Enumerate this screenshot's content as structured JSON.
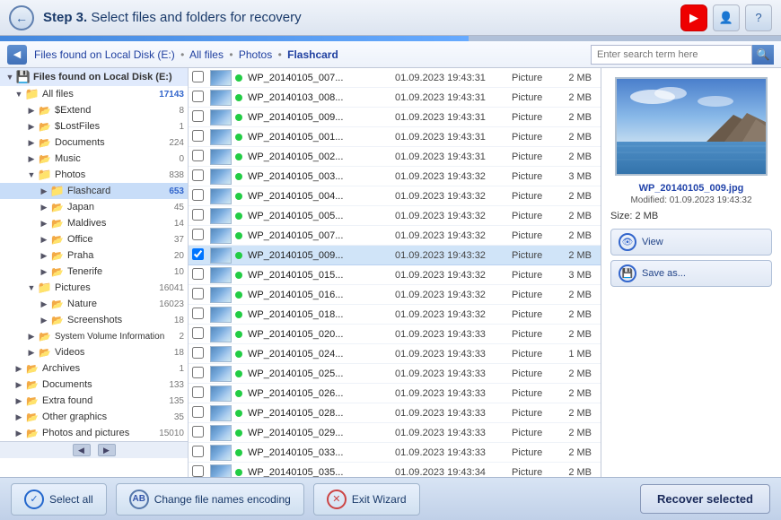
{
  "titleBar": {
    "stepLabel": "Step 3.",
    "stepDesc": " Select files and folders for recovery",
    "backBtn": "←",
    "youtubeIcon": "▶",
    "userIcon": "👤",
    "helpIcon": "?"
  },
  "breadcrumb": {
    "navIcon": "◀",
    "parts": [
      "Files found on Local Disk (E:)",
      "All files",
      "Photos",
      "Flashcard"
    ],
    "searchPlaceholder": "Enter search term here",
    "searchIcon": "🔍"
  },
  "sidebar": {
    "items": [
      {
        "label": "Files found on Local Disk (E:)",
        "level": 0,
        "type": "root",
        "expanded": true
      },
      {
        "label": "All files",
        "count": "17143",
        "level": 1,
        "type": "folder",
        "expanded": true,
        "selected": false,
        "countStyle": "blue"
      },
      {
        "label": "$Extend",
        "count": "8",
        "level": 2,
        "type": "folder"
      },
      {
        "label": "$LostFiles",
        "count": "1",
        "level": 2,
        "type": "folder"
      },
      {
        "label": "Documents",
        "count": "224",
        "level": 2,
        "type": "folder"
      },
      {
        "label": "Music",
        "count": "0",
        "level": 2,
        "type": "folder"
      },
      {
        "label": "Photos",
        "count": "838",
        "level": 2,
        "type": "folder",
        "expanded": true
      },
      {
        "label": "Flashcard",
        "count": "653",
        "level": 3,
        "type": "folder",
        "selected": true
      },
      {
        "label": "Japan",
        "count": "45",
        "level": 3,
        "type": "folder"
      },
      {
        "label": "Maldives",
        "count": "14",
        "level": 3,
        "type": "folder"
      },
      {
        "label": "Office",
        "count": "37",
        "level": 3,
        "type": "folder"
      },
      {
        "label": "Praha",
        "count": "20",
        "level": 3,
        "type": "folder"
      },
      {
        "label": "Tenerife",
        "count": "10",
        "level": 3,
        "type": "folder"
      },
      {
        "label": "Pictures",
        "count": "16041",
        "level": 2,
        "type": "folder",
        "expanded": true
      },
      {
        "label": "Nature",
        "count": "16023",
        "level": 3,
        "type": "folder"
      },
      {
        "label": "Screenshots",
        "count": "18",
        "level": 3,
        "type": "folder"
      },
      {
        "label": "System Volume Information",
        "count": "2",
        "level": 2,
        "type": "folder"
      },
      {
        "label": "Videos",
        "count": "18",
        "level": 2,
        "type": "folder"
      },
      {
        "label": "Archives",
        "count": "1",
        "level": 1,
        "type": "folder"
      },
      {
        "label": "Documents",
        "count": "133",
        "level": 1,
        "type": "folder"
      },
      {
        "label": "Extra found",
        "count": "135",
        "level": 1,
        "type": "folder"
      },
      {
        "label": "Other graphics",
        "count": "35",
        "level": 1,
        "type": "folder"
      },
      {
        "label": "Photos and pictures",
        "count": "15010",
        "level": 1,
        "type": "folder"
      }
    ]
  },
  "fileList": {
    "rows": [
      {
        "name": "WP_20140105_007...",
        "date": "01.09.2023 19:43:31",
        "type": "Picture",
        "size": "2 MB",
        "dot": "green",
        "selected": false
      },
      {
        "name": "WP_20140103_008...",
        "date": "01.09.2023 19:43:31",
        "type": "Picture",
        "size": "2 MB",
        "dot": "green",
        "selected": false
      },
      {
        "name": "WP_20140105_009...",
        "date": "01.09.2023 19:43:31",
        "type": "Picture",
        "size": "2 MB",
        "dot": "green",
        "selected": false
      },
      {
        "name": "WP_20140105_001...",
        "date": "01.09.2023 19:43:31",
        "type": "Picture",
        "size": "2 MB",
        "dot": "green",
        "selected": false
      },
      {
        "name": "WP_20140105_002...",
        "date": "01.09.2023 19:43:31",
        "type": "Picture",
        "size": "2 MB",
        "dot": "green",
        "selected": false
      },
      {
        "name": "WP_20140105_003...",
        "date": "01.09.2023 19:43:32",
        "type": "Picture",
        "size": "3 MB",
        "dot": "green",
        "selected": false
      },
      {
        "name": "WP_20140105_004...",
        "date": "01.09.2023 19:43:32",
        "type": "Picture",
        "size": "2 MB",
        "dot": "green",
        "selected": false
      },
      {
        "name": "WP_20140105_005...",
        "date": "01.09.2023 19:43:32",
        "type": "Picture",
        "size": "2 MB",
        "dot": "green",
        "selected": false
      },
      {
        "name": "WP_20140105_007...",
        "date": "01.09.2023 19:43:32",
        "type": "Picture",
        "size": "2 MB",
        "dot": "green",
        "selected": false
      },
      {
        "name": "WP_20140105_009...",
        "date": "01.09.2023 19:43:32",
        "type": "Picture",
        "size": "2 MB",
        "dot": "green",
        "selected": true
      },
      {
        "name": "WP_20140105_015...",
        "date": "01.09.2023 19:43:32",
        "type": "Picture",
        "size": "3 MB",
        "dot": "green",
        "selected": false
      },
      {
        "name": "WP_20140105_016...",
        "date": "01.09.2023 19:43:32",
        "type": "Picture",
        "size": "2 MB",
        "dot": "green",
        "selected": false
      },
      {
        "name": "WP_20140105_018...",
        "date": "01.09.2023 19:43:32",
        "type": "Picture",
        "size": "2 MB",
        "dot": "green",
        "selected": false
      },
      {
        "name": "WP_20140105_020...",
        "date": "01.09.2023 19:43:33",
        "type": "Picture",
        "size": "2 MB",
        "dot": "green",
        "selected": false
      },
      {
        "name": "WP_20140105_024...",
        "date": "01.09.2023 19:43:33",
        "type": "Picture",
        "size": "1 MB",
        "dot": "green",
        "selected": false
      },
      {
        "name": "WP_20140105_025...",
        "date": "01.09.2023 19:43:33",
        "type": "Picture",
        "size": "2 MB",
        "dot": "green",
        "selected": false
      },
      {
        "name": "WP_20140105_026...",
        "date": "01.09.2023 19:43:33",
        "type": "Picture",
        "size": "2 MB",
        "dot": "green",
        "selected": false
      },
      {
        "name": "WP_20140105_028...",
        "date": "01.09.2023 19:43:33",
        "type": "Picture",
        "size": "2 MB",
        "dot": "green",
        "selected": false
      },
      {
        "name": "WP_20140105_029...",
        "date": "01.09.2023 19:43:33",
        "type": "Picture",
        "size": "2 MB",
        "dot": "green",
        "selected": false
      },
      {
        "name": "WP_20140105_033...",
        "date": "01.09.2023 19:43:33",
        "type": "Picture",
        "size": "2 MB",
        "dot": "green",
        "selected": false
      },
      {
        "name": "WP_20140105_035...",
        "date": "01.09.2023 19:43:34",
        "type": "Picture",
        "size": "2 MB",
        "dot": "green",
        "selected": false
      }
    ]
  },
  "preview": {
    "filename": "WP_20140105_009.jpg",
    "modified": "Modified: 01.09.2023 19:43:32",
    "size": "Size: 2 MB",
    "viewLabel": "View",
    "saveAsLabel": "Save as..."
  },
  "bottomBar": {
    "selectAllLabel": "Select all",
    "encodingLabel": "Change file names encoding",
    "exitLabel": "Exit Wizard",
    "recoverLabel": "Recover selected"
  }
}
